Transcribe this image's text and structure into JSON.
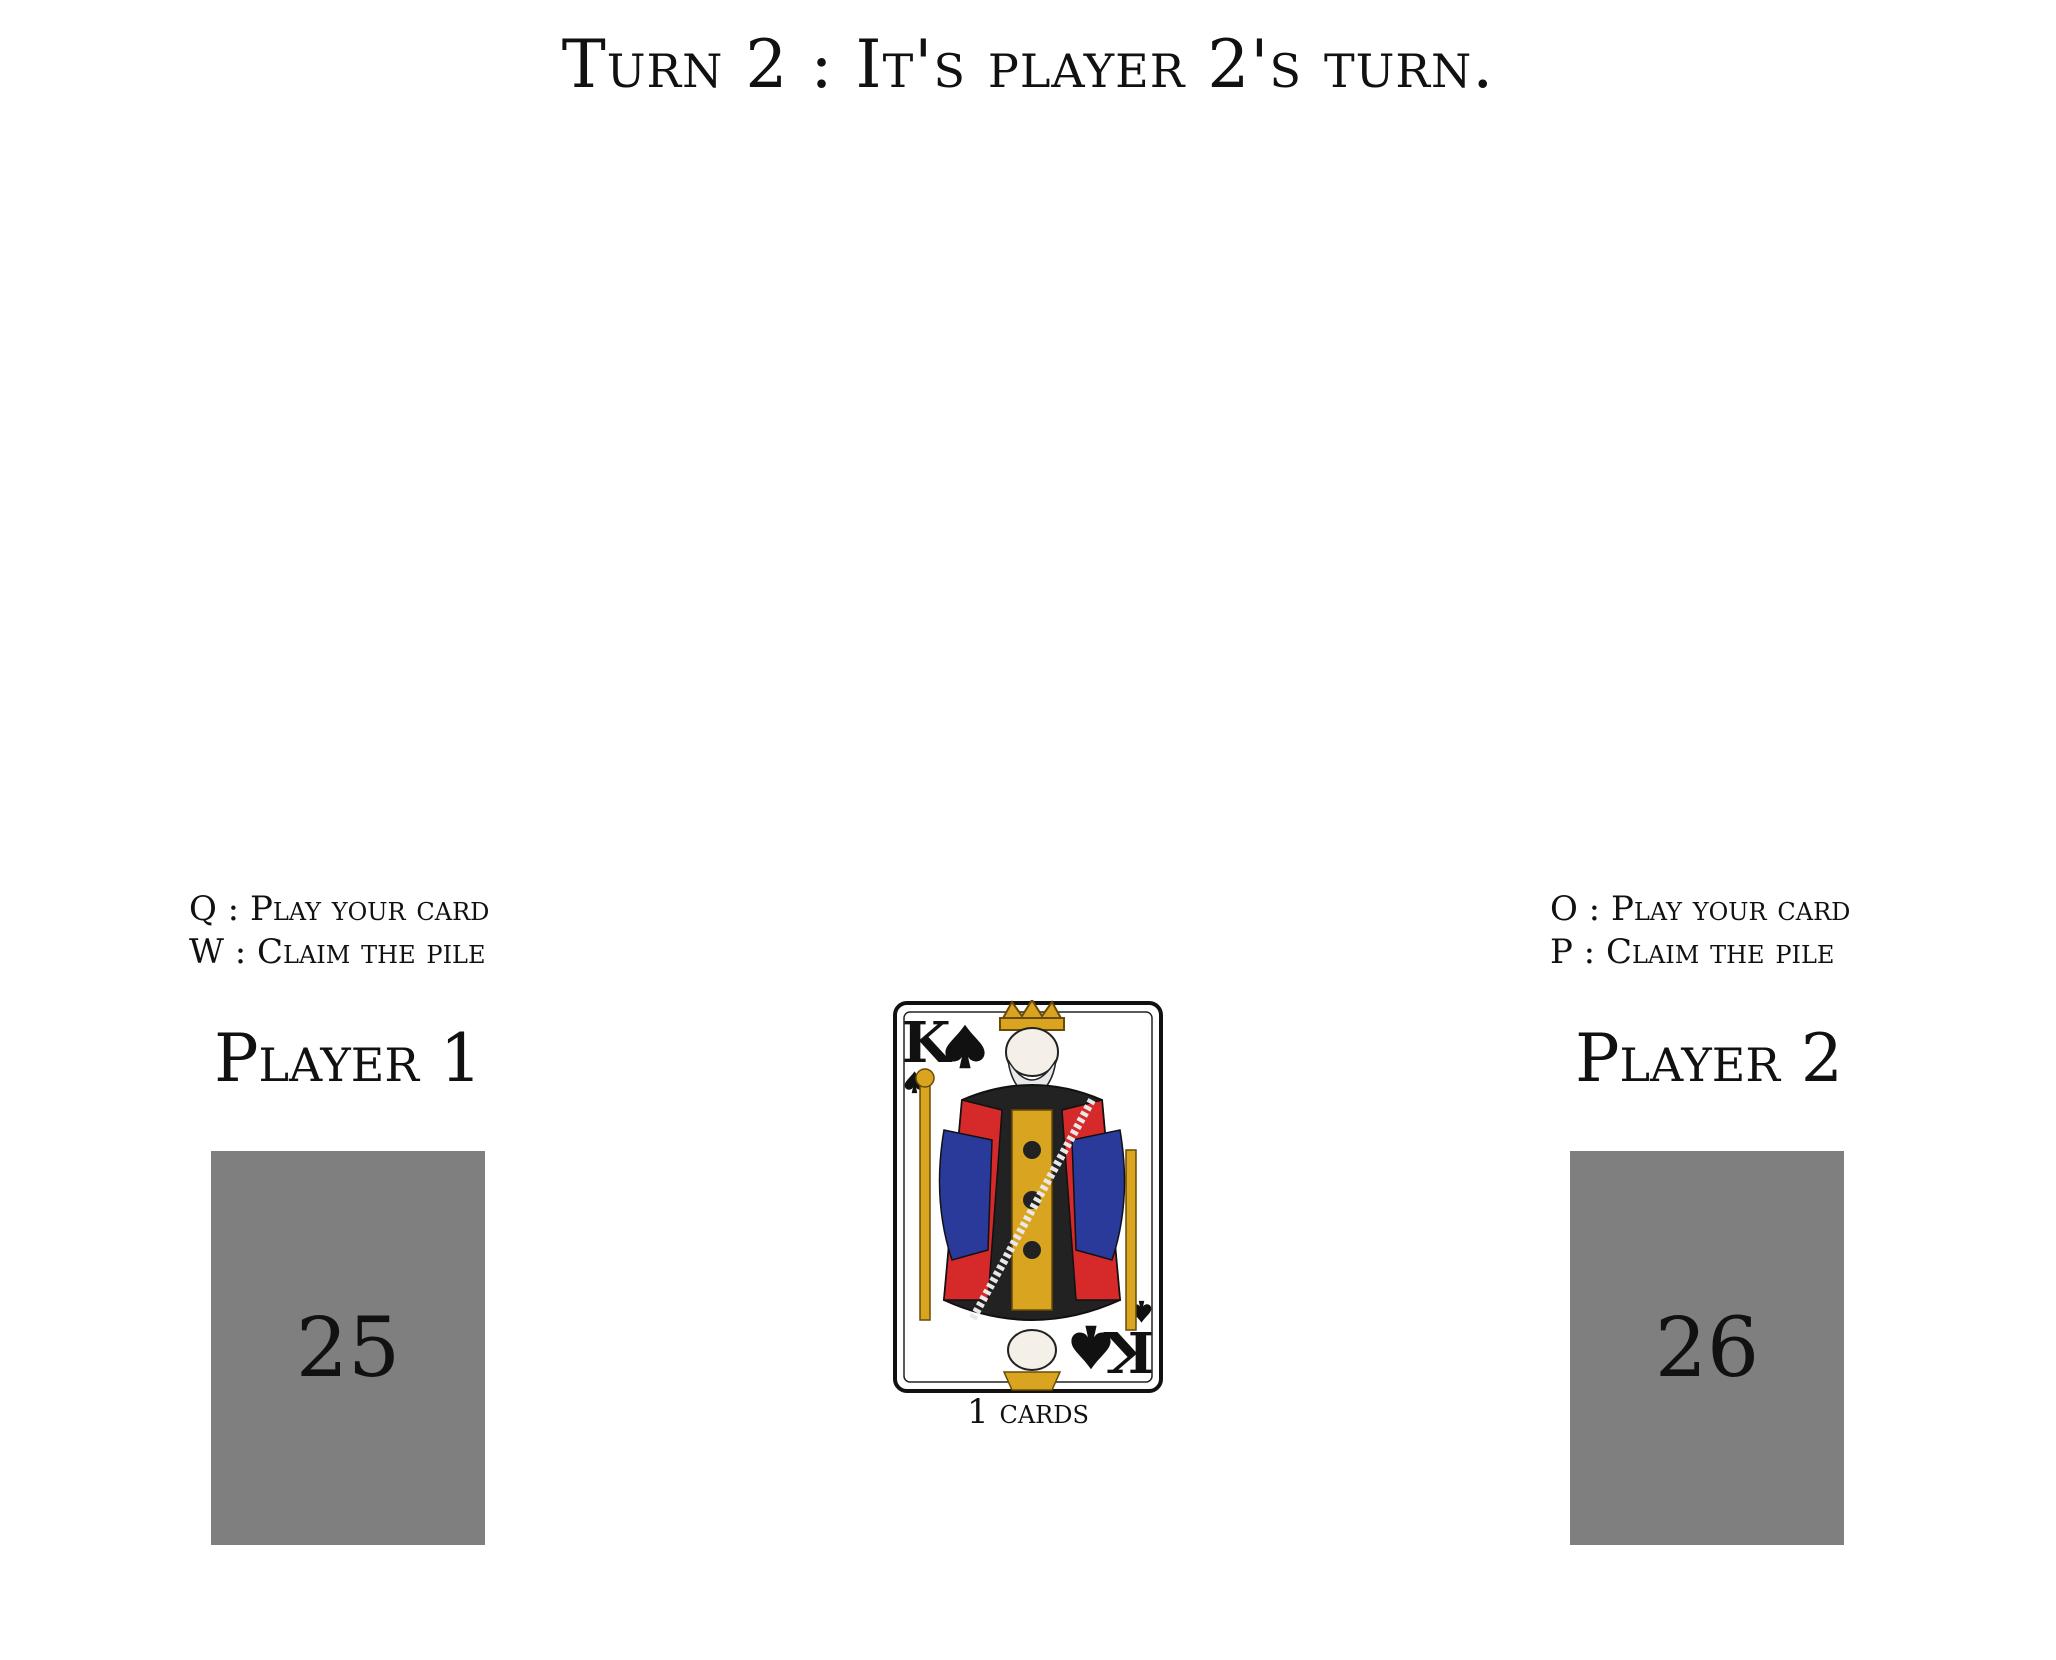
{
  "status": {
    "text": "Turn 2 : It's player 2's turn."
  },
  "players": [
    {
      "name": "Player 1",
      "controls": [
        "Q : Play your card",
        "W : Claim the pile"
      ],
      "deck_count": "25"
    },
    {
      "name": "Player 2",
      "controls": [
        "O : Play your card",
        "P : Claim the pile"
      ],
      "deck_count": "26"
    }
  ],
  "pile": {
    "top_card": {
      "rank": "K",
      "suit": "spade",
      "suit_icon": "spade-icon"
    },
    "count_label": "1 cards"
  },
  "colors": {
    "deck": "#7f7f7f",
    "robe_red": "#d62a2a",
    "robe_blue": "#2a3a9a",
    "gold": "#d9a521",
    "text": "#111111"
  }
}
